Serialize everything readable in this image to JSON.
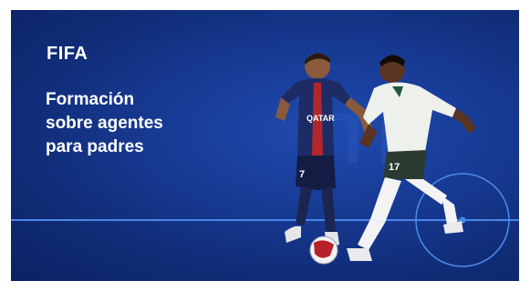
{
  "banner": {
    "logo": "FIFA",
    "headline_lines": [
      "Formación",
      "sobre agentes",
      "para padres"
    ],
    "colors": {
      "background": "#173a93",
      "pitch_lines": "#4a86e8",
      "text": "#ffffff"
    }
  },
  "players": {
    "left_jersey_sponsor": "QATAR",
    "left_jersey_number": "7",
    "right_jersey_number": "17"
  },
  "icons": [
    "soccer-ball-icon"
  ]
}
